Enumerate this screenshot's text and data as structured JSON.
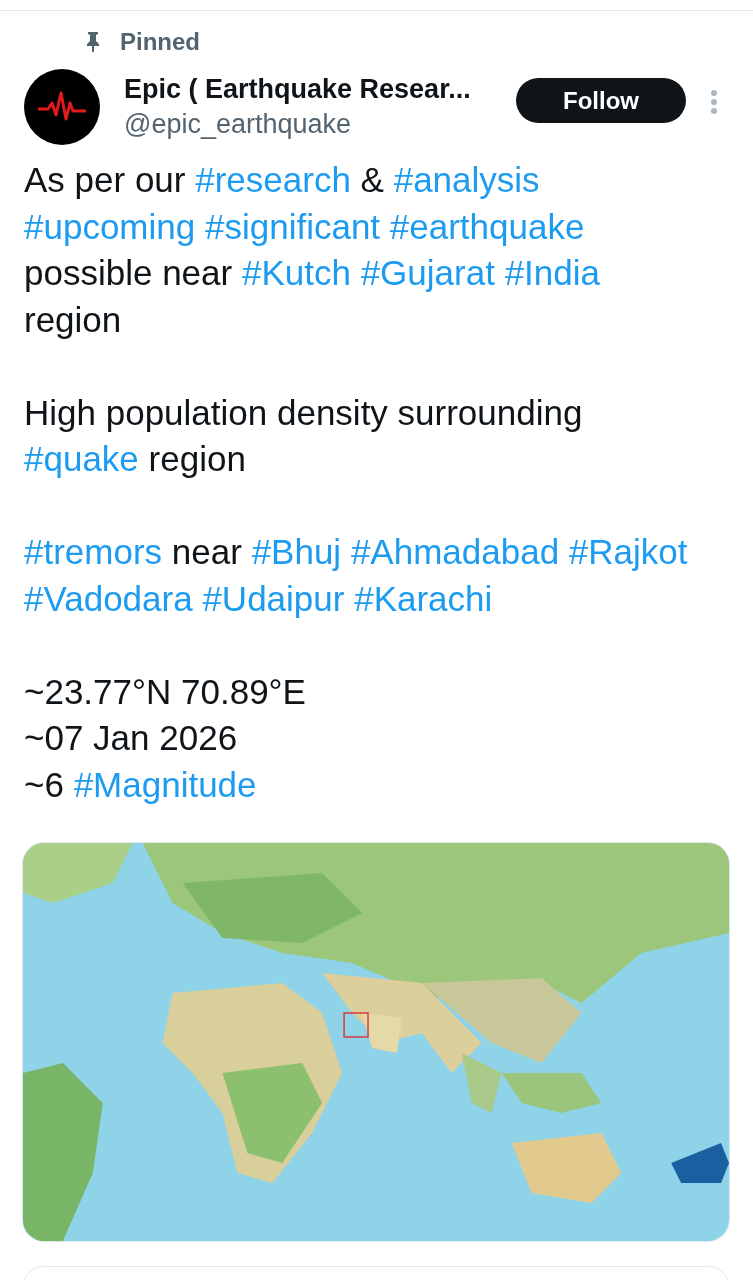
{
  "pinned": {
    "label": "Pinned"
  },
  "author": {
    "name": "Epic ( Earthquake Resear...",
    "handle": "@epic_earthquake"
  },
  "follow_button": {
    "label": "Follow"
  },
  "paragraphs": [
    [
      [
        {
          "kind": "text",
          "text": "As per our"
        },
        {
          "kind": "hashtag",
          "text": "#research"
        },
        {
          "kind": "text",
          "text": "&"
        },
        {
          "kind": "hashtag",
          "text": "#analysis"
        }
      ],
      [
        {
          "kind": "hashtag",
          "text": "#upcoming"
        },
        {
          "kind": "hashtag",
          "text": "#significant"
        },
        {
          "kind": "hashtag",
          "text": "#earthquake"
        }
      ],
      [
        {
          "kind": "text",
          "text": "possible near"
        },
        {
          "kind": "hashtag",
          "text": "#Kutch"
        },
        {
          "kind": "hashtag",
          "text": "#Gujarat"
        },
        {
          "kind": "hashtag",
          "text": "#India"
        }
      ],
      [
        {
          "kind": "text",
          "text": "region"
        }
      ]
    ],
    [
      [
        {
          "kind": "text",
          "text": "High population density surrounding"
        }
      ],
      [
        {
          "kind": "hashtag",
          "text": "#quake"
        },
        {
          "kind": "text",
          "text": "region"
        }
      ]
    ],
    [
      [
        {
          "kind": "hashtag",
          "text": "#tremors"
        },
        {
          "kind": "text",
          "text": "near"
        },
        {
          "kind": "hashtag",
          "text": "#Bhuj"
        },
        {
          "kind": "hashtag",
          "text": "#Ahmadabad"
        },
        {
          "kind": "hashtag",
          "text": "#Rajkot"
        }
      ],
      [
        {
          "kind": "hashtag",
          "text": "#Vadodara"
        },
        {
          "kind": "hashtag",
          "text": "#Udaipur"
        },
        {
          "kind": "hashtag",
          "text": "#Karachi"
        }
      ]
    ],
    [
      [
        {
          "kind": "text",
          "text": "~23.77°N 70.89°E"
        }
      ],
      [
        {
          "kind": "text",
          "text": "~07 Jan 2026"
        }
      ],
      [
        {
          "kind": "text",
          "text": "~6"
        },
        {
          "kind": "hashtag",
          "text": "#Magnitude"
        }
      ]
    ]
  ],
  "media": {
    "kind": "picture"
  }
}
